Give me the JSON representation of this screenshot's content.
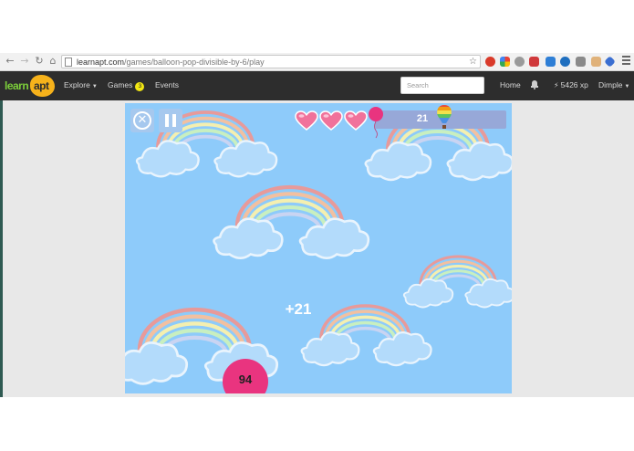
{
  "browser": {
    "url_host": "learnapt.com",
    "url_path": "/games/balloon-pop-divisible-by-6/play"
  },
  "site": {
    "logo_learn": "learn",
    "logo_apt": "apt",
    "nav": {
      "explore_label": "Explore",
      "games_label": "Games",
      "games_badge": "3",
      "events_label": "Events"
    },
    "search_placeholder": "Search",
    "home_label": "Home",
    "xp_label": "5426 xp",
    "user_label": "Dimple"
  },
  "game": {
    "lives": 3,
    "score": "21",
    "points_popup": "+21",
    "target_balloon_number": "94"
  },
  "colors": {
    "sky": "#8ecbfa",
    "balloon": "#e9347f",
    "heart": "#f0729b",
    "nav_bg": "#2d2d2d",
    "score_panel": "#97a8d8"
  },
  "icons": {
    "back": "back-arrow-icon",
    "forward": "forward-arrow-icon",
    "reload": "reload-icon",
    "home": "home-icon",
    "bookmark": "star-icon",
    "close": "close-circle-icon",
    "pause": "pause-icon",
    "notifications": "bell-icon",
    "xp": "lightning-icon"
  }
}
